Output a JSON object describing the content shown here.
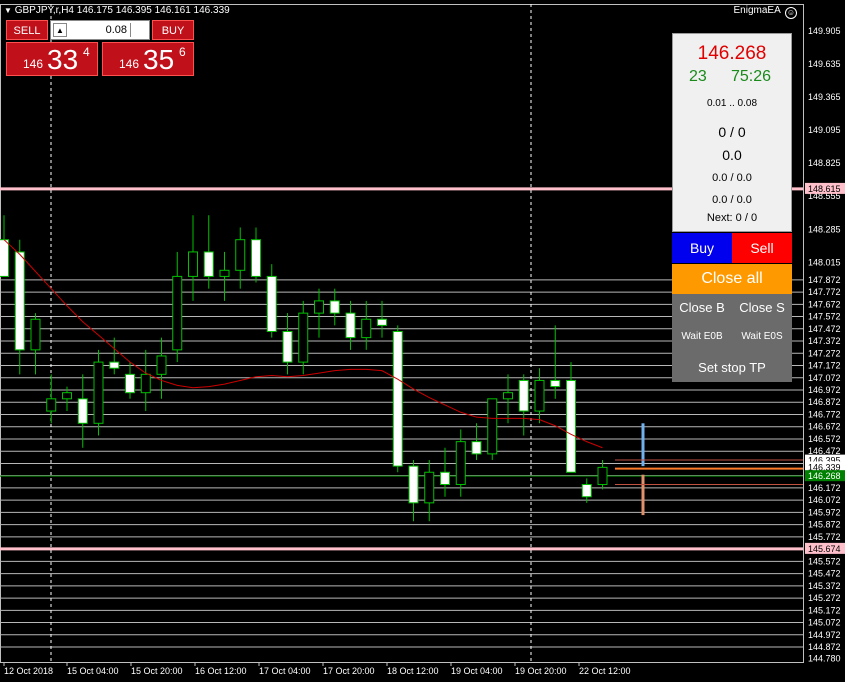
{
  "symbol_bar": {
    "text": "GBPJPY,r,H4  146.175 146.395 146.161 146.339"
  },
  "ea_label": "EnigmaEA",
  "one_click": {
    "sell_label": "SELL",
    "buy_label": "BUY",
    "lot_value": "0.08",
    "bid_prefix": "146",
    "bid_big": "33",
    "bid_sup": "4",
    "ask_prefix": "146",
    "ask_big": "35",
    "ask_sup": "6"
  },
  "ea_panel": {
    "price": "146.268",
    "spread": "23",
    "timer": "75:26",
    "lot_range": "0.01 .. 0.08",
    "orders": "0 / 0",
    "profit": "0.0",
    "profit_pair": "0.0 / 0.0",
    "profit_pair2": "0.0 / 0.0",
    "next": "Next: 0 / 0",
    "buy_label": "Buy",
    "sell_label": "Sell",
    "close_all_label": "Close all",
    "close_b_label": "Close B",
    "close_s_label": "Close S",
    "wait_eob_label": "Wait E0B",
    "wait_eos_label": "Wait E0S",
    "set_stop_tp_label": "Set stop TP"
  },
  "colors": {
    "bg": "#000000",
    "bull": "#00c000",
    "ma": "#cc0000",
    "pink_level": "#ffc0cb",
    "grid": "#c0c0c0",
    "pink_tag": "#ffc0cb"
  },
  "chart_data": {
    "type": "candlestick",
    "symbol": "GBPJPY,r,H4",
    "ohlc_header": [
      146.175,
      146.395,
      146.161,
      146.339
    ],
    "price_axis": [
      "149.905",
      "149.635",
      "149.365",
      "149.095",
      "148.825",
      "148.555",
      "148.285",
      "148.015",
      "147.872",
      "147.772",
      "147.672",
      "147.572",
      "147.472",
      "147.372",
      "147.272",
      "147.172",
      "147.072",
      "146.972",
      "146.872",
      "146.772",
      "146.672",
      "146.572",
      "146.472",
      "146.395",
      "146.339",
      "146.272",
      "146.172",
      "146.072",
      "145.972",
      "145.872",
      "145.772",
      "145.674",
      "145.572",
      "145.472",
      "145.372",
      "145.272",
      "145.172",
      "145.072",
      "144.972",
      "144.872",
      "144.780"
    ],
    "price_tags": [
      {
        "label": "148.615",
        "value": 148.615,
        "style": "pink"
      },
      {
        "label": "146.395",
        "value": 146.395,
        "style": "white"
      },
      {
        "label": "146.339",
        "value": 146.339,
        "style": "white"
      },
      {
        "label": "146.268",
        "value": 146.268,
        "style": "green"
      },
      {
        "label": "145.674",
        "value": 145.674,
        "style": "pink"
      }
    ],
    "horizontal_levels": [
      147.872,
      147.772,
      147.672,
      147.572,
      147.472,
      147.372,
      147.272,
      147.172,
      147.072,
      146.972,
      146.872,
      146.772,
      146.672,
      146.572,
      146.472,
      146.372,
      146.272,
      146.172,
      146.072,
      145.972,
      145.872,
      145.772,
      145.572,
      145.472,
      145.372,
      145.272,
      145.172,
      145.072,
      144.972,
      144.872
    ],
    "pink_levels": [
      148.615,
      145.674
    ],
    "time_labels": [
      "12 Oct 2018",
      "15 Oct 04:00",
      "15 Oct 20:00",
      "16 Oct 12:00",
      "17 Oct 04:00",
      "17 Oct 20:00",
      "18 Oct 12:00",
      "19 Oct 04:00",
      "19 Oct 20:00",
      "22 Oct 12:00"
    ],
    "candles": [
      {
        "o": 148.2,
        "h": 148.4,
        "l": 147.9,
        "c": 147.9
      },
      {
        "o": 148.1,
        "h": 148.2,
        "l": 147.1,
        "c": 147.3
      },
      {
        "o": 147.3,
        "h": 147.6,
        "l": 147.1,
        "c": 147.55
      },
      {
        "o": 146.8,
        "h": 147.1,
        "l": 146.7,
        "c": 146.9
      },
      {
        "o": 146.9,
        "h": 147.0,
        "l": 146.8,
        "c": 146.95
      },
      {
        "o": 146.9,
        "h": 147.1,
        "l": 146.5,
        "c": 146.7
      },
      {
        "o": 146.7,
        "h": 147.3,
        "l": 146.6,
        "c": 147.2
      },
      {
        "o": 147.2,
        "h": 147.4,
        "l": 147.1,
        "c": 147.15
      },
      {
        "o": 147.1,
        "h": 147.2,
        "l": 146.9,
        "c": 146.95
      },
      {
        "o": 146.95,
        "h": 147.3,
        "l": 146.8,
        "c": 147.1
      },
      {
        "o": 147.1,
        "h": 147.4,
        "l": 146.9,
        "c": 147.25
      },
      {
        "o": 147.3,
        "h": 148.1,
        "l": 147.2,
        "c": 147.9
      },
      {
        "o": 147.9,
        "h": 148.4,
        "l": 147.7,
        "c": 148.1
      },
      {
        "o": 148.1,
        "h": 148.4,
        "l": 147.8,
        "c": 147.9
      },
      {
        "o": 147.9,
        "h": 148.1,
        "l": 147.7,
        "c": 147.95
      },
      {
        "o": 147.95,
        "h": 148.3,
        "l": 147.8,
        "c": 148.2
      },
      {
        "o": 148.2,
        "h": 148.3,
        "l": 147.85,
        "c": 147.9
      },
      {
        "o": 147.9,
        "h": 148.0,
        "l": 147.4,
        "c": 147.45
      },
      {
        "o": 147.45,
        "h": 147.6,
        "l": 147.1,
        "c": 147.2
      },
      {
        "o": 147.2,
        "h": 147.7,
        "l": 147.1,
        "c": 147.6
      },
      {
        "o": 147.6,
        "h": 147.8,
        "l": 147.4,
        "c": 147.7
      },
      {
        "o": 147.7,
        "h": 147.8,
        "l": 147.5,
        "c": 147.6
      },
      {
        "o": 147.6,
        "h": 147.7,
        "l": 147.3,
        "c": 147.4
      },
      {
        "o": 147.4,
        "h": 147.7,
        "l": 147.3,
        "c": 147.55
      },
      {
        "o": 147.55,
        "h": 147.7,
        "l": 147.4,
        "c": 147.5
      },
      {
        "o": 147.45,
        "h": 147.5,
        "l": 146.3,
        "c": 146.35
      },
      {
        "o": 146.35,
        "h": 146.4,
        "l": 145.9,
        "c": 146.05
      },
      {
        "o": 146.05,
        "h": 146.4,
        "l": 145.9,
        "c": 146.3
      },
      {
        "o": 146.3,
        "h": 146.5,
        "l": 146.1,
        "c": 146.2
      },
      {
        "o": 146.2,
        "h": 146.65,
        "l": 146.1,
        "c": 146.55
      },
      {
        "o": 146.55,
        "h": 146.7,
        "l": 146.4,
        "c": 146.45
      },
      {
        "o": 146.45,
        "h": 146.9,
        "l": 146.4,
        "c": 146.9
      },
      {
        "o": 146.9,
        "h": 147.1,
        "l": 146.7,
        "c": 146.95
      },
      {
        "o": 147.05,
        "h": 147.1,
        "l": 146.6,
        "c": 146.8
      },
      {
        "o": 146.8,
        "h": 147.15,
        "l": 146.7,
        "c": 147.05
      },
      {
        "o": 147.05,
        "h": 147.5,
        "l": 146.9,
        "c": 147.0
      },
      {
        "o": 147.05,
        "h": 147.2,
        "l": 146.5,
        "c": 146.3
      },
      {
        "o": 146.2,
        "h": 146.25,
        "l": 146.05,
        "c": 146.1
      },
      {
        "o": 146.2,
        "h": 146.4,
        "l": 146.16,
        "c": 146.34
      }
    ],
    "ma_series": [
      148.2,
      148.08,
      147.94,
      147.8,
      147.66,
      147.53,
      147.42,
      147.31,
      147.2,
      147.11,
      147.05,
      147.01,
      146.99,
      147.0,
      147.02,
      147.05,
      147.08,
      147.09,
      147.08,
      147.09,
      147.11,
      147.13,
      147.14,
      147.14,
      147.13,
      147.06,
      146.98,
      146.91,
      146.85,
      146.79,
      146.75,
      146.74,
      146.74,
      146.74,
      146.73,
      146.68,
      146.61,
      146.55,
      146.5
    ]
  }
}
